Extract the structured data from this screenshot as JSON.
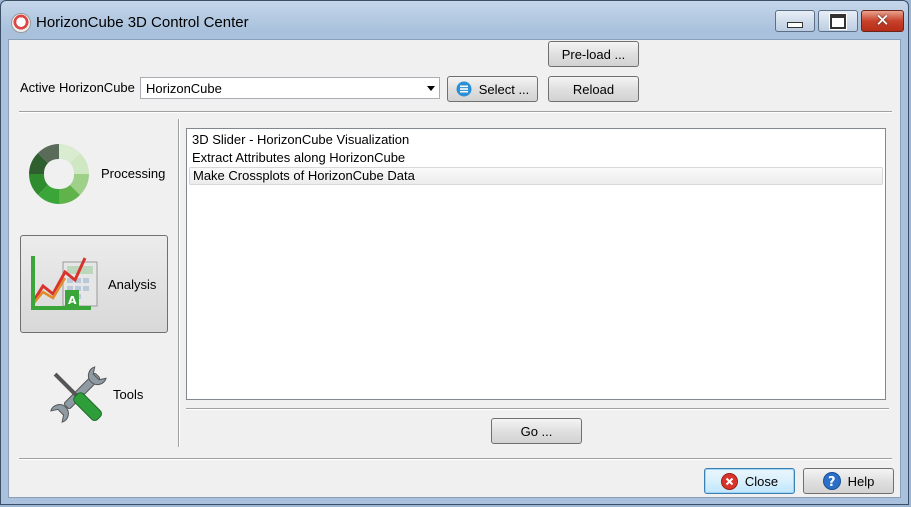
{
  "window": {
    "title": "HorizonCube 3D Control Center",
    "app_icon": "horizoncube-app-icon",
    "controls": [
      "minimize",
      "maximize",
      "close"
    ]
  },
  "toolbar": {
    "preload_label": "Pre-load ...",
    "active_label": "Active HorizonCube",
    "active_value": "HorizonCube",
    "select_label": "Select ...",
    "reload_label": "Reload"
  },
  "categories": [
    {
      "label": "Processing",
      "icon": "processing-ring-icon",
      "selected": false
    },
    {
      "label": "Analysis",
      "icon": "analysis-chart-icon",
      "selected": true
    },
    {
      "label": "Tools",
      "icon": "tools-wrench-screwdriver-icon",
      "selected": false
    }
  ],
  "list": {
    "items": [
      "3D Slider - HorizonCube Visualization",
      "Extract Attributes along HorizonCube",
      "Make Crossplots of HorizonCube Data"
    ],
    "selected_index": 2
  },
  "go_label": "Go ...",
  "footer": {
    "close_label": "Close",
    "help_label": "Help"
  },
  "colors": {
    "processing_green": "#3aa63a",
    "close_icon_red": "#d8342c",
    "help_icon_blue": "#2a6fc9",
    "select_icon_blue": "#2b8fd6"
  }
}
